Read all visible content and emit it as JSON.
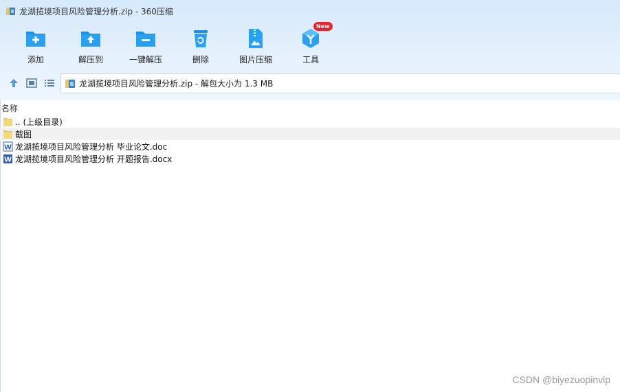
{
  "window": {
    "title": "龙湖揽境项目风险管理分析.zip - 360压缩"
  },
  "toolbar": {
    "items": [
      {
        "label": "添加",
        "icon": "add-folder-icon"
      },
      {
        "label": "解压到",
        "icon": "extract-to-icon"
      },
      {
        "label": "一键解压",
        "icon": "one-click-extract-icon"
      },
      {
        "label": "删除",
        "icon": "delete-icon"
      },
      {
        "label": "图片压缩",
        "icon": "image-compress-icon"
      },
      {
        "label": "工具",
        "icon": "tools-icon",
        "badge": "New"
      }
    ]
  },
  "navbar": {
    "address": "龙湖揽境项目风险管理分析.zip - 解包大小为 1.3 MB"
  },
  "list": {
    "column_name": "名称",
    "rows": [
      {
        "name": ".. (上级目录)",
        "icon": "folder-icon"
      },
      {
        "name": "截图",
        "icon": "folder-icon"
      },
      {
        "name": "龙湖揽境项目风险管理分析 毕业论文.doc",
        "icon": "word-doc-icon"
      },
      {
        "name": "龙湖揽境项目风险管理分析 开题报告.docx",
        "icon": "word-docx-icon"
      }
    ]
  },
  "watermark": "CSDN @biyezuopinvip",
  "colors": {
    "accent": "#1c8fe8",
    "badge": "#e8252c",
    "folder": "#f7d877"
  }
}
